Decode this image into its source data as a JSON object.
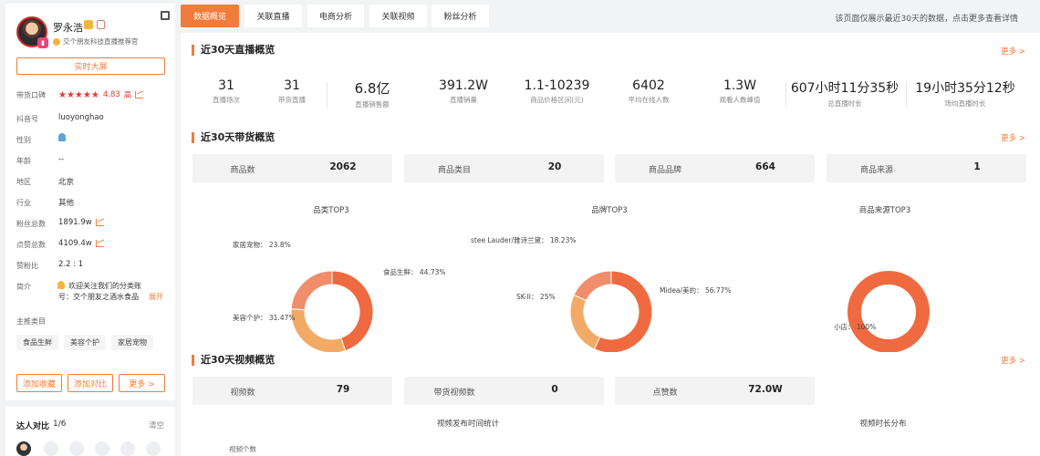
{
  "nav": {
    "tabs": [
      "数据概览",
      "关联直播",
      "电商分析",
      "关联视频",
      "粉丝分析"
    ],
    "notice": "该页面仅展示最近30天的数据，点击更多查看详情"
  },
  "profile": {
    "name": "罗永浩",
    "verify": "交个朋友科技直播推荐官",
    "big_screen": "实时大屏",
    "rows": [
      {
        "label": "带货口碑",
        "value": "4.83",
        "extra": "高"
      },
      {
        "label": "抖音号",
        "value": "luoyonghao"
      },
      {
        "label": "性别",
        "value": ""
      },
      {
        "label": "年龄",
        "value": "--"
      },
      {
        "label": "地区",
        "value": "北京"
      },
      {
        "label": "行业",
        "value": "其他"
      },
      {
        "label": "粉丝总数",
        "value": "1891.9w"
      },
      {
        "label": "点赞总数",
        "value": "4109.4w"
      },
      {
        "label": "赞粉比",
        "value": "2.2 : 1"
      }
    ],
    "intro_label": "简介",
    "intro_line1": "欢迎关注我们的分类账",
    "intro_line2": "号：交个朋友之酒水食品",
    "intro_expand": "展开",
    "category_label": "主推类目",
    "category_tags": [
      "食品生鲜",
      "美容个护",
      "家居宠物"
    ],
    "actions": [
      "添加收藏",
      "添加对比",
      "更多 >"
    ]
  },
  "compare": {
    "title": "达人对比",
    "count": "1/6",
    "clear": "清空"
  },
  "live": {
    "title": "近30天直播概览",
    "more": "更多 >",
    "stats": [
      {
        "value": "31",
        "label": "直播场次"
      },
      {
        "value": "31",
        "label": "带货直播"
      },
      {
        "value": "6.8亿",
        "label": "直播销售额"
      },
      {
        "value": "391.2W",
        "label": "直播销量"
      },
      {
        "value": "1.1-10239",
        "label": "商品价格区间(元)"
      },
      {
        "value": "6402",
        "label": "平均在线人数"
      },
      {
        "value": "1.3W",
        "label": "观看人数峰值"
      },
      {
        "value": "607小时11分35秒",
        "label": "总直播时长"
      },
      {
        "value": "19小时35分12秒",
        "label": "场均直播时长"
      }
    ]
  },
  "goods": {
    "title": "近30天带货概览",
    "more": "更多 >",
    "boxes": [
      {
        "label": "商品数",
        "value": "2062"
      },
      {
        "label": "商品类目",
        "value": "20"
      },
      {
        "label": "商品品牌",
        "value": "664"
      },
      {
        "label": "商品来源",
        "value": "1"
      }
    ]
  },
  "video": {
    "title": "近30天视频概览",
    "more": "更多 >",
    "boxes": [
      {
        "label": "视频数",
        "value": "79"
      },
      {
        "label": "带货视频数",
        "value": "0"
      },
      {
        "label": "点赞数",
        "value": "72.0W"
      }
    ],
    "chart1_title": "视频发布时间统计",
    "chart2_title": "视频时长分布",
    "chart1_ylabel": "视频个数"
  },
  "chart_data": [
    {
      "type": "pie",
      "title": "品类TOP3",
      "labels": [
        "食品生鲜",
        "美容个护",
        "家居宠物"
      ],
      "values": [
        44.73,
        31.47,
        23.8
      ],
      "colors": [
        "#ef6a40",
        "#f3aa67",
        "#f08e6b"
      ]
    },
    {
      "type": "pie",
      "title": "品牌TOP3",
      "labels": [
        "Midea/美的",
        "SK-II",
        "stee Lauder/雅诗兰黛"
      ],
      "values": [
        56.77,
        25,
        18.23
      ],
      "colors": [
        "#ef6a40",
        "#f3aa67",
        "#f08e6b"
      ]
    },
    {
      "type": "pie",
      "title": "商品来源TOP3",
      "labels": [
        "小店"
      ],
      "values": [
        100
      ],
      "colors": [
        "#ef6a40"
      ]
    }
  ]
}
